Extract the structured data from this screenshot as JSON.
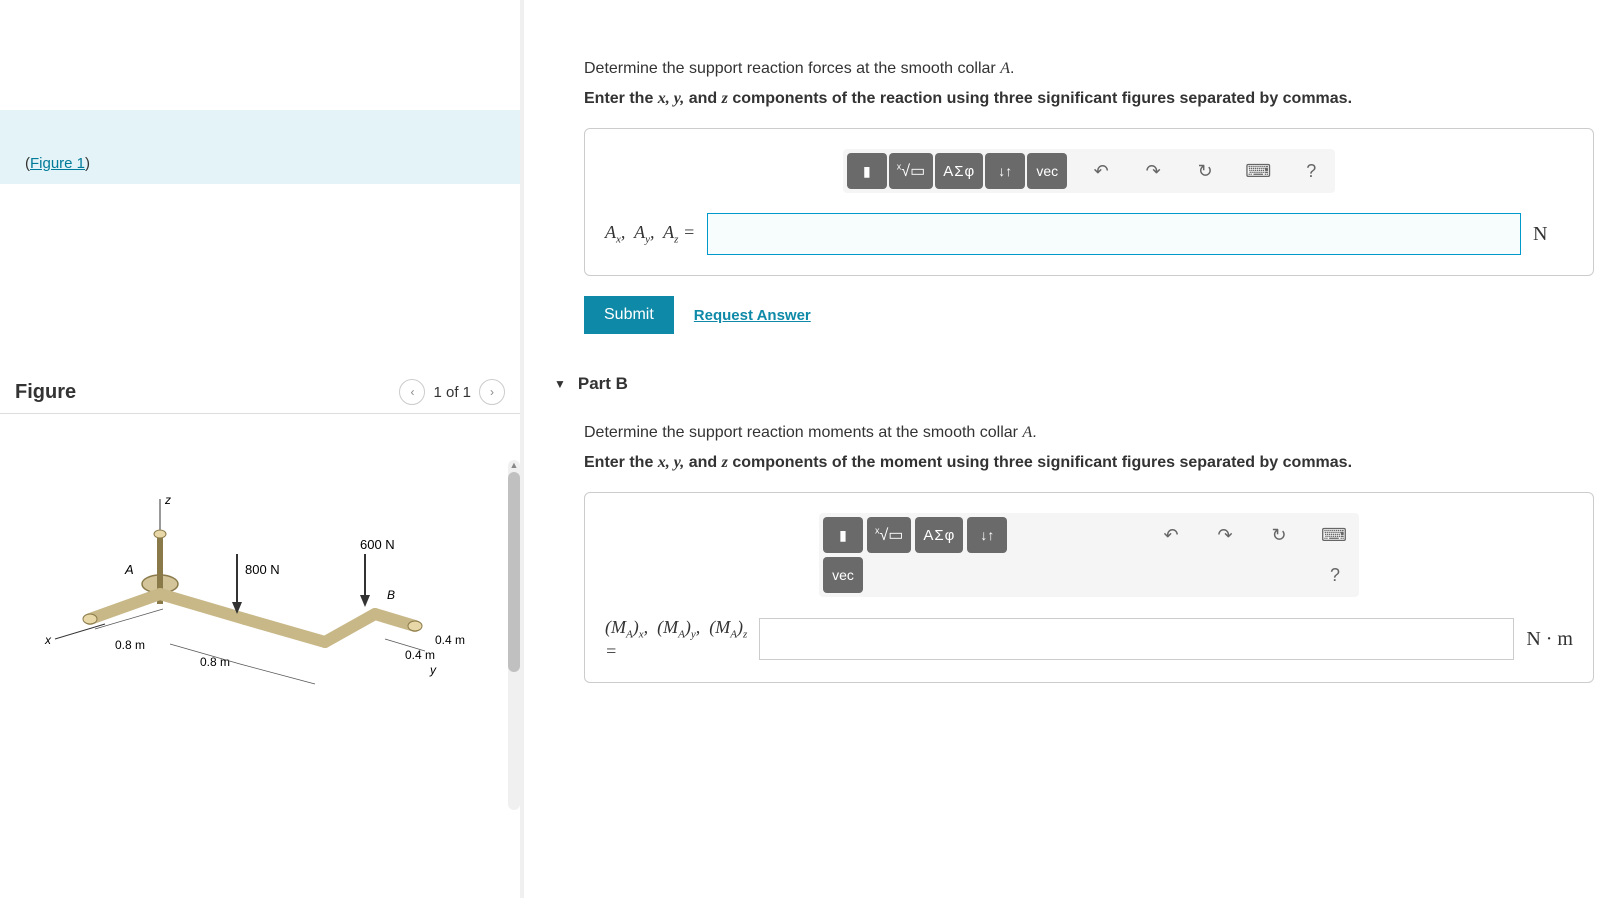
{
  "leftPanel": {
    "figureRef": "Figure 1",
    "figureTitle": "Figure",
    "navText": "1 of 1",
    "diagram": {
      "pointA": "A",
      "pointB": "B",
      "force1": "800 N",
      "force2": "600 N",
      "dim1": "0.8 m",
      "dim2": "0.8 m",
      "dim3": "0.4 m",
      "dim4": "0.4 m",
      "axisX": "x",
      "axisY": "y",
      "axisZ": "z"
    }
  },
  "partA": {
    "question": "Determine the support reaction forces at the smooth collar ",
    "questionVar": "A",
    "questionEnd": ".",
    "instruction1": "Enter the ",
    "instructionVars": "x, y,",
    "instruction2": " and ",
    "instructionVar3": "z",
    "instruction3": " components of the reaction using three significant figures separated by commas.",
    "answerLabel": "Aₓ,  Aᵧ,  A_z =",
    "unit": "N",
    "submit": "Submit",
    "requestAnswer": "Request Answer",
    "toolbar": {
      "sqrt": "√",
      "greek": "ΑΣφ",
      "arrows": "↓↑",
      "vec": "vec",
      "undo": "↶",
      "redo": "↷",
      "reset": "↻",
      "keyboard": "⌨",
      "help": "?"
    }
  },
  "partB": {
    "title": "Part B",
    "question": "Determine the support reaction moments at the smooth collar ",
    "questionVar": "A",
    "questionEnd": ".",
    "instruction1": "Enter the ",
    "instructionVars": "x, y,",
    "instruction2": " and ",
    "instructionVar3": "z",
    "instruction3": " components of the moment using three significant figures separated by commas.",
    "answerLabel": "(M_A)ₓ,  (M_A)ᵧ,  (M_A)_z =",
    "unit": "N · m",
    "toolbar": {
      "sqrt": "√",
      "greek": "ΑΣφ",
      "arrows": "↓↑",
      "vec": "vec",
      "undo": "↶",
      "redo": "↷",
      "reset": "↻",
      "keyboard": "⌨",
      "help": "?"
    }
  }
}
